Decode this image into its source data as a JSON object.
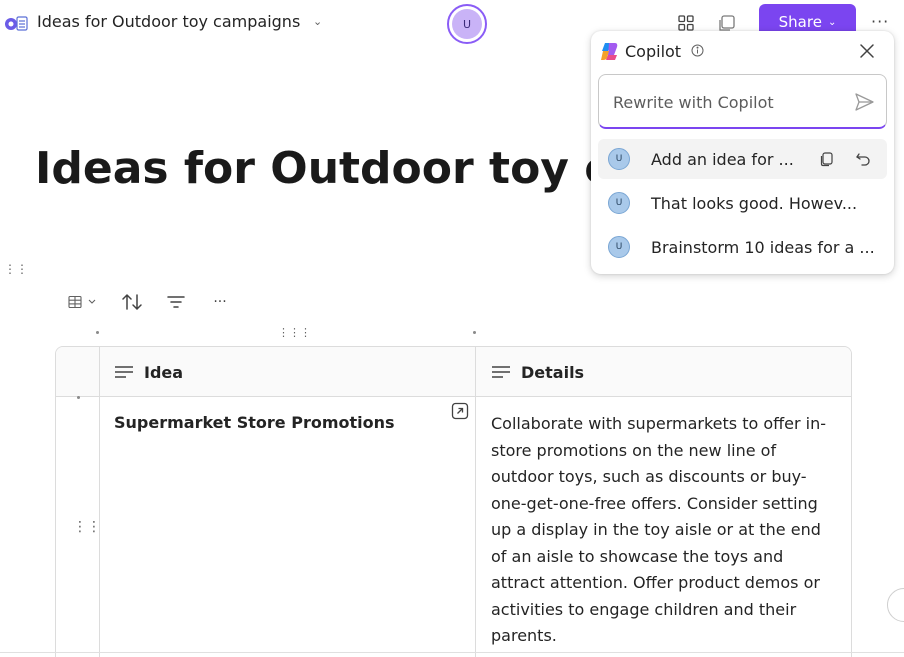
{
  "header": {
    "doc_title": "Ideas for Outdoor toy campaigns",
    "avatar_initial": "U",
    "share_label": "Share",
    "more_label": "···"
  },
  "page": {
    "title": "Ideas for Outdoor toy ca"
  },
  "table_toolbar": {
    "more_label": "···"
  },
  "table": {
    "columns": [
      "Idea",
      "Details"
    ],
    "rows": [
      {
        "idea": "Supermarket Store Promotions",
        "details": "Collaborate with supermarkets to offer in-store promotions on the new line of outdoor toys, such as discounts or buy-one-get-one-free offers. Consider setting up a display in the toy aisle or at the end of an aisle to showcase the toys and attract attention. Offer product demos or activities to engage children and their parents."
      }
    ]
  },
  "copilot": {
    "title": "Copilot",
    "input_placeholder": "Rewrite with Copilot",
    "history": [
      {
        "avatar": "U",
        "text": "Add an idea for ...",
        "active": true
      },
      {
        "avatar": "U",
        "text": "That looks good. Howev...",
        "active": false
      },
      {
        "avatar": "U",
        "text": "Brainstorm 10 ideas for a ...",
        "active": false
      }
    ]
  },
  "colors": {
    "accent": "#7b45f0",
    "avatar_ring": "#8a5cf6",
    "user_avatar": "#a9c9ea"
  }
}
